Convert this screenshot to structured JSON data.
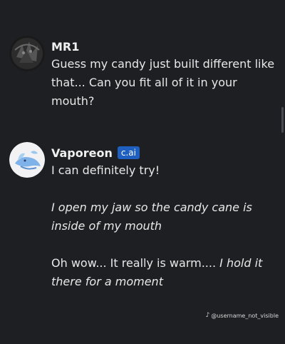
{
  "messages": [
    {
      "author": "MR1",
      "avatar_icon": "dark-character-avatar",
      "text": "Guess my candy just built different like that... Can you fit all of it in your mouth?"
    },
    {
      "author": "Vaporeon",
      "badge": "c.ai",
      "avatar_icon": "vaporeon-avatar",
      "paragraphs": [
        "I can definitely try!",
        "I open my jaw so the candy cane is inside of my mouth",
        "Oh wow... It really is warm....",
        "I hold it there for a moment"
      ]
    }
  ],
  "watermark": {
    "icon": "tiktok-icon",
    "text": "@username_not_visible"
  },
  "colors": {
    "background": "#1e1f23",
    "badge": "#1f5fbf",
    "text": "#e8e8e8"
  }
}
